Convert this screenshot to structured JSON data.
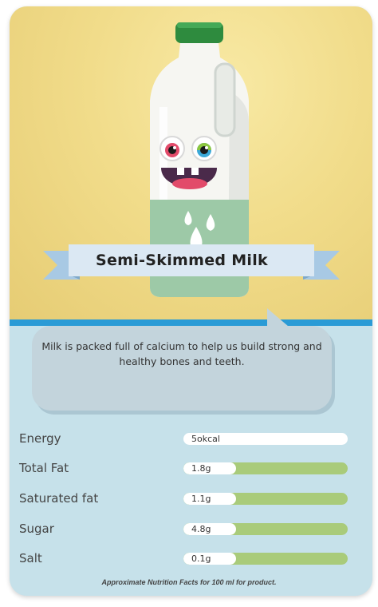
{
  "product": {
    "name": "Semi-Skimmed Milk",
    "description": "Milk is packed full of calcium to help us build strong and healthy bones and teeth."
  },
  "nutrition": [
    {
      "label": "Energy",
      "value": "5okcal"
    },
    {
      "label": "Total Fat",
      "value": "1.8g"
    },
    {
      "label": "Saturated fat",
      "value": "1.1g"
    },
    {
      "label": "Sugar",
      "value": "4.8g"
    },
    {
      "label": "Salt",
      "value": "0.1g"
    }
  ],
  "footnote": "Approximate  Nutrition Facts for 100 ml for product.",
  "colors": {
    "background_top": "#f1dc8a",
    "background_bottom": "#c6e1ea",
    "divider": "#2a9bd6",
    "bar_fill": "#a9cb7a",
    "ribbon": "#dbe8f3",
    "cap": "#2e8b3e"
  },
  "icons": [
    "milk-bottle-icon",
    "milk-drop-icon"
  ]
}
